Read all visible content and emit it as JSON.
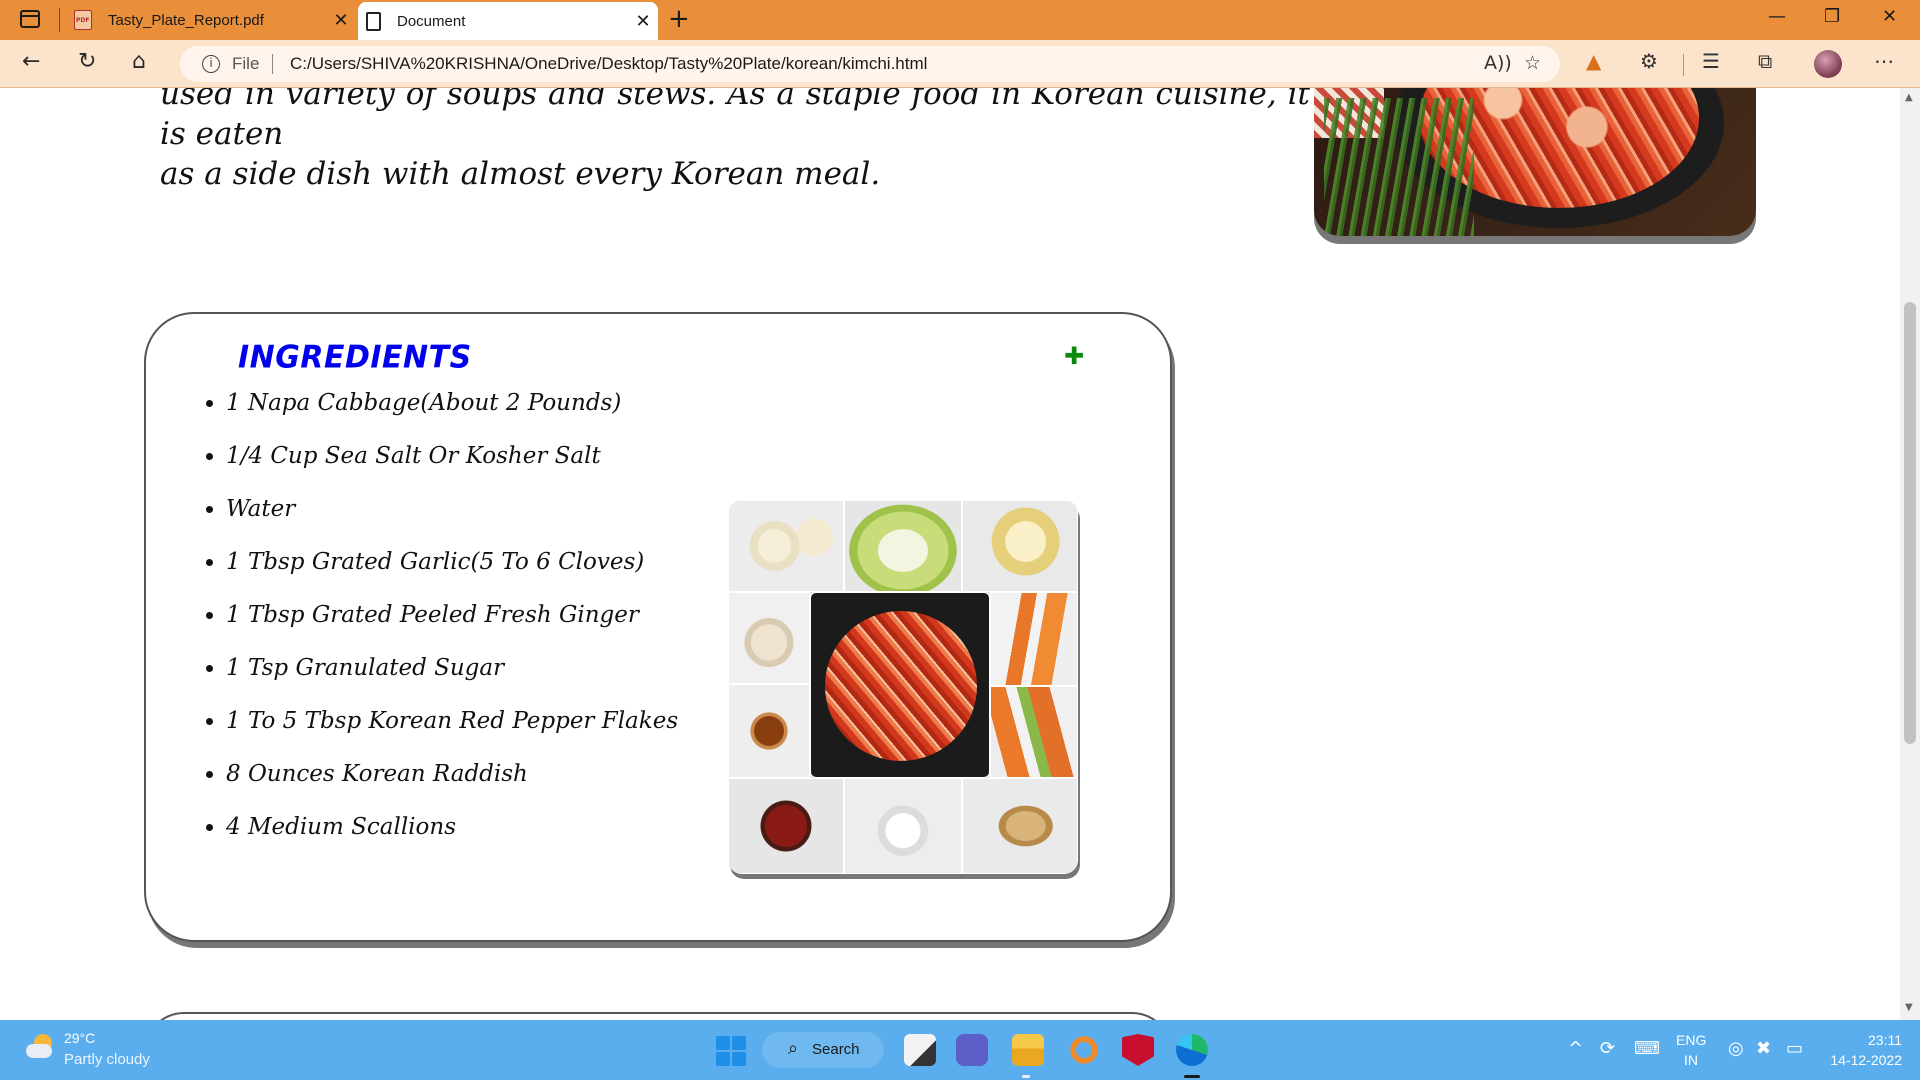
{
  "browser": {
    "tabs": [
      {
        "title": "Tasty_Plate_Report.pdf",
        "favicon": "pdf-icon",
        "active": false
      },
      {
        "title": "Document",
        "favicon": "document-icon",
        "active": true
      }
    ],
    "new_tab_symbol": "+",
    "address": {
      "scheme_label": "File",
      "url": "C:/Users/SHIVA%20KRISHNA/OneDrive/Desktop/Tasty%20Plate/korean/kimchi.html"
    },
    "accent_color": "#e98f3a"
  },
  "page": {
    "intro_lines": [
      "used in variety of soups and stews. As a staple food in Korean cuisine, it is eaten",
      "as a side dish with almost every Korean meal."
    ],
    "ingredients": {
      "title": "INGREDIENTS",
      "title_color": "#0000ee",
      "items": [
        "1 Napa Cabbage(About 2 Pounds)",
        "1/4 Cup Sea Salt Or Kosher Salt",
        "Water",
        "1 Tbsp Grated Garlic(5 To 6 Cloves)",
        "1 Tbsp Grated Peeled Fresh Ginger",
        "1 Tsp Granulated Sugar",
        "1 To 5 Tbsp Korean Red Pepper Flakes",
        "8 Ounces Korean Raddish",
        "4 Medium Scallions"
      ]
    }
  },
  "taskbar": {
    "weather": {
      "temp": "29°C",
      "condition": "Partly cloudy"
    },
    "search_label": "Search",
    "language": {
      "line1": "ENG",
      "line2": "IN"
    },
    "time": "23:11",
    "date": "14-12-2022"
  }
}
